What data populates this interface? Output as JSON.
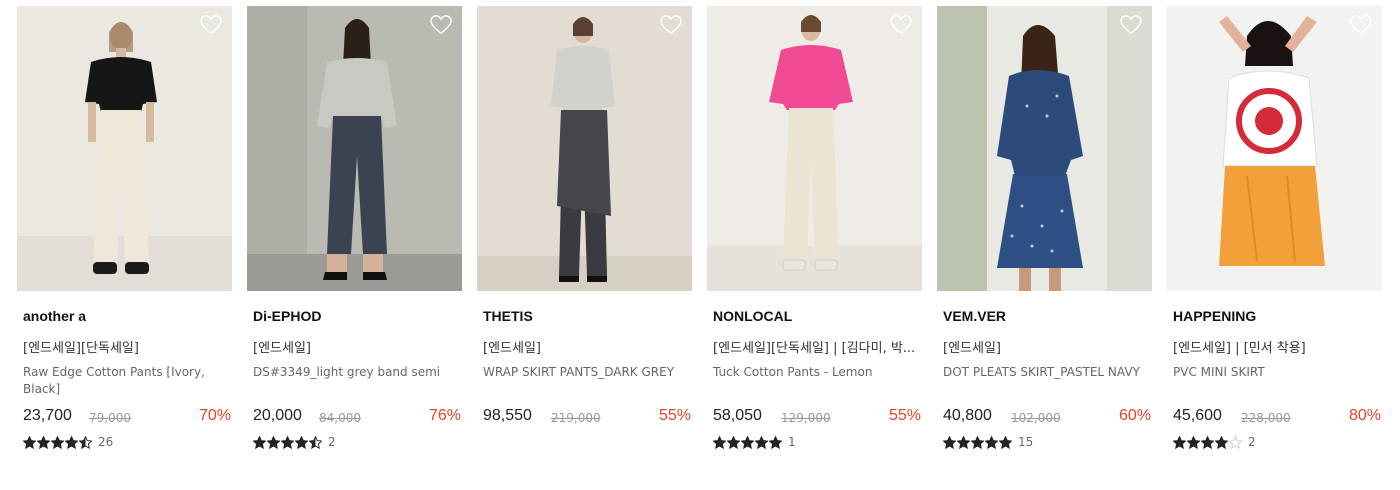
{
  "colors": {
    "discount": "#e8442a",
    "star": "#222222",
    "star_empty": "#cccccc"
  },
  "products": [
    {
      "brand": "another a",
      "tag": "[엔드세일][단독세일]",
      "name": "Raw Edge Cotton Pants [Ivory, Black]",
      "price": "23,700",
      "original_price": "79,000",
      "discount": "70%",
      "rating_stars": 4.5,
      "review_count": "26",
      "image": "model-black-top-ivory-wide-pants"
    },
    {
      "brand": "Di-EPHOD",
      "tag": "[엔드세일]",
      "name": "DS#3349_light grey band semi",
      "price": "20,000",
      "original_price": "84,000",
      "discount": "76%",
      "rating_stars": 4.5,
      "review_count": "2",
      "image": "model-grey-knit-navy-pants"
    },
    {
      "brand": "THETIS",
      "tag": "[엔드세일]",
      "name": "WRAP SKIRT PANTS_DARK GREY",
      "price": "98,550",
      "original_price": "219,000",
      "discount": "55%",
      "rating_stars": null,
      "review_count": "",
      "image": "model-grey-top-dark-wrap-skirt-pants"
    },
    {
      "brand": "NONLOCAL",
      "tag": "[엔드세일][단독세일] | [김다미, 박...",
      "name": "Tuck Cotton Pants - Lemon",
      "price": "58,050",
      "original_price": "129,000",
      "discount": "55%",
      "rating_stars": 5,
      "review_count": "1",
      "image": "model-pink-cardigan-cream-pants"
    },
    {
      "brand": "VEM.VER",
      "tag": "[엔드세일]",
      "name": "DOT PLEATS SKIRT_PASTEL NAVY",
      "price": "40,800",
      "original_price": "102,000",
      "discount": "60%",
      "rating_stars": 5,
      "review_count": "15",
      "image": "model-navy-dot-dress"
    },
    {
      "brand": "HAPPENING",
      "tag": "[엔드세일] | [민서 착용]",
      "name": "PVC MINI SKIRT",
      "price": "45,600",
      "original_price": "228,000",
      "discount": "80%",
      "rating_stars": 4,
      "review_count": "2",
      "image": "model-white-graphic-tee-orange-skirt"
    }
  ]
}
